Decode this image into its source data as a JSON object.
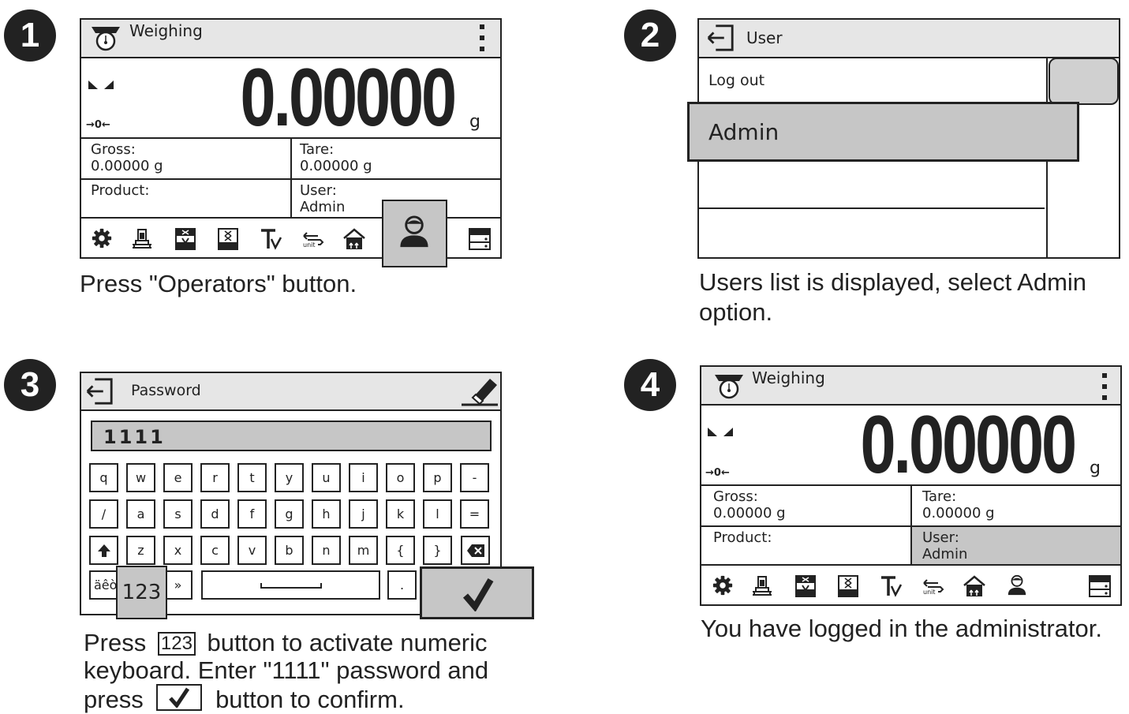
{
  "steps": {
    "s1": {
      "num": "1",
      "title": "Weighing",
      "value": "0.00000",
      "unit": "g",
      "zero": "→0←",
      "gross_label": "Gross:",
      "gross_value": "0.00000 g",
      "tare_label": "Tare:",
      "tare_value": "0.00000 g",
      "product_label": "Product:",
      "user_label": "User:",
      "user_value": "Admin",
      "caption": "Press \"Operators\" button."
    },
    "s2": {
      "num": "2",
      "title": "User",
      "logout": "Log out",
      "admin": "Admin",
      "caption_line1": "Users list is displayed, select Admin",
      "caption_line2": "option."
    },
    "s3": {
      "num": "3",
      "title": "Password",
      "input_value": "1111",
      "keys_row1": [
        "q",
        "w",
        "e",
        "r",
        "t",
        "y",
        "u",
        "i",
        "o",
        "p",
        "-"
      ],
      "keys_row2": [
        "/",
        "a",
        "s",
        "d",
        "f",
        "g",
        "h",
        "j",
        "k",
        "l",
        "="
      ],
      "keys_row3": [
        "z",
        "x",
        "c",
        "v",
        "b",
        "n",
        "m",
        "{",
        "}"
      ],
      "accents_label": "äêò",
      "num_key_label": "123",
      "quote_key": "»",
      "dot_key": ".",
      "caption_press": "Press",
      "caption_key": "123",
      "caption_rest": "button to activate numeric",
      "caption_line2": "keyboard. Enter \"1111\" password and",
      "caption_line3a": "press",
      "caption_line3b": "button to confirm."
    },
    "s4": {
      "num": "4",
      "title": "Weighing",
      "value": "0.00000",
      "unit": "g",
      "zero": "→0←",
      "gross_label": "Gross:",
      "gross_value": "0.00000 g",
      "tare_label": "Tare:",
      "tare_value": "0.00000 g",
      "product_label": "Product:",
      "user_label": "User:",
      "user_value": "Admin",
      "caption": "You have logged in the administrator."
    }
  },
  "icons": [
    "gear-icon",
    "scale-icon",
    "checkweigh-icon",
    "statistics-icon",
    "tare-icon",
    "unit-icon",
    "home-icon",
    "operator-icon",
    "database-icon"
  ],
  "colors": {
    "dark": "#222222",
    "bar": "#e6e6e6",
    "highlight": "#c6c6c6"
  }
}
